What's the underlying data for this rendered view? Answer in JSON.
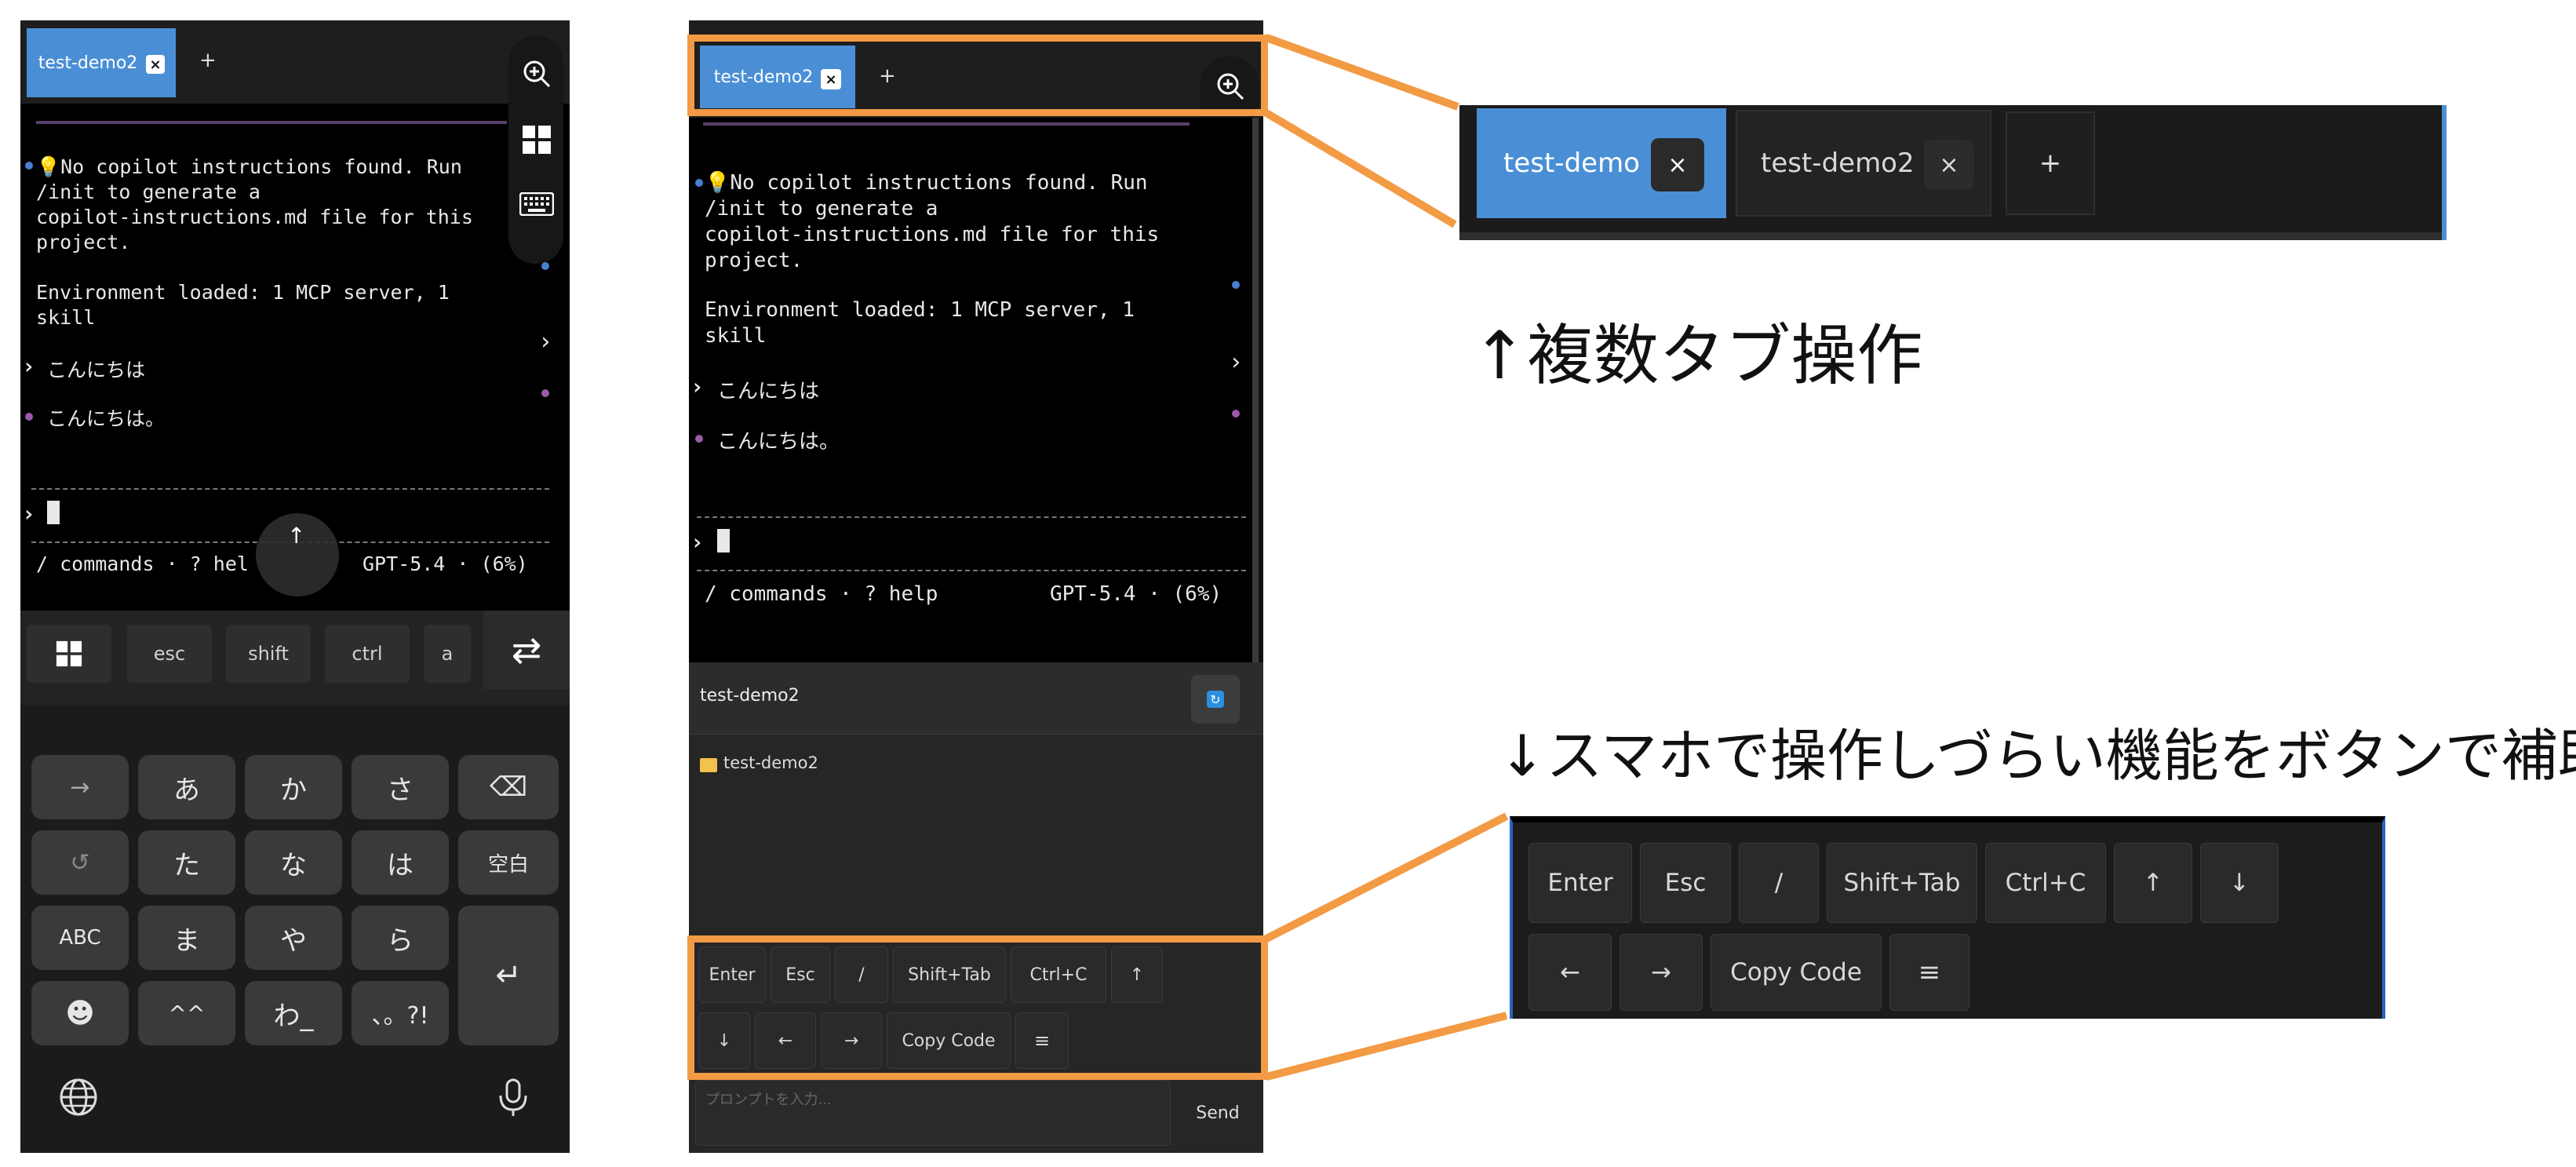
{
  "tabs": {
    "active": "test-demo2",
    "close": "×",
    "add": "+"
  },
  "zoom_tabs": {
    "tab1": "test-demo",
    "tab2": "test-demo2",
    "close": "×",
    "add": "+"
  },
  "terminal": {
    "line1": "💡No copilot instructions found. Run",
    "line2": "/init to generate a",
    "line3": "copilot-instructions.md file for this",
    "line4": "project.",
    "env1": "Environment loaded: 1 MCP server, 1",
    "env2": "skill",
    "user_msg": "こんにちは",
    "reply": "こんにちは。",
    "prompt": "›",
    "left_phone_status": "/ commands · ? hel",
    "status_left": "/ commands · ? help",
    "status_right": "GPT-5.4 · (6%)"
  },
  "rail_icons": [
    "zoom-in-icon",
    "windows-icon",
    "keyboard-icon"
  ],
  "keyboard": {
    "func_keys": [
      "esc",
      "shift",
      "ctrl",
      "a"
    ],
    "rows": [
      [
        "→",
        "あ",
        "か",
        "さ",
        "⌫"
      ],
      [
        "↺",
        "た",
        "な",
        "は",
        "空白"
      ],
      [
        "ABC",
        "ま",
        "や",
        "ら",
        "↵"
      ],
      [
        "☻",
        "^^",
        "わ_",
        "、。?!"
      ]
    ]
  },
  "explorer": {
    "header": "test-demo2",
    "folder": "test-demo2"
  },
  "helper_buttons": {
    "row1": [
      "Enter",
      "Esc",
      "/",
      "Shift+Tab",
      "Ctrl+C",
      "↑"
    ],
    "row2": [
      "↓",
      "←",
      "→",
      "Copy Code",
      "≡"
    ]
  },
  "input": {
    "placeholder": "プロンプトを入力...",
    "send": "Send"
  },
  "zoom_helper": {
    "row1": [
      "Enter",
      "Esc",
      "/",
      "Shift+Tab",
      "Ctrl+C",
      "↑",
      "↓"
    ],
    "row2": [
      "←",
      "→",
      "Copy Code",
      "≡"
    ]
  },
  "captions": {
    "tabs": "↑複数タブ操作",
    "buttons": "↓スマホで操作しづらい機能をボタンで補助"
  },
  "colors": {
    "accent_orange": "#f39a44",
    "active_tab": "#4a8fd6"
  }
}
